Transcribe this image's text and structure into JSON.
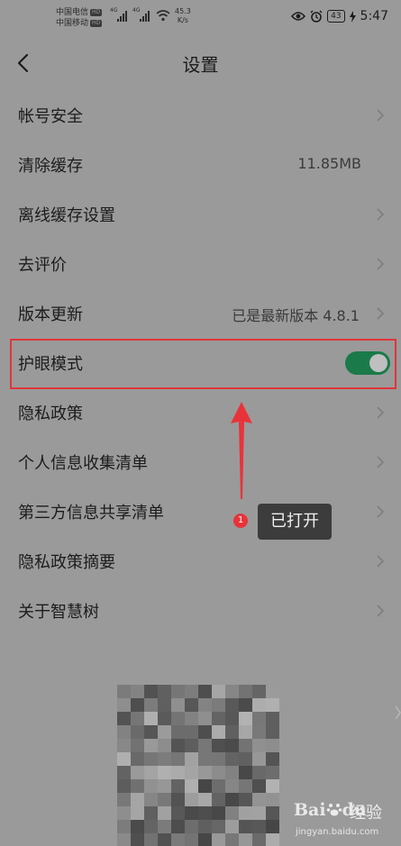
{
  "status_bar": {
    "carrier1": "中国电信",
    "carrier2": "中国移动",
    "hd": "HD",
    "sig_tag": "4G",
    "speed_value": "45.3",
    "speed_unit": "K/s",
    "battery": "43",
    "time": "5:47"
  },
  "header": {
    "title": "设置"
  },
  "rows": [
    {
      "label": "帐号安全"
    },
    {
      "label": "清除缓存",
      "value": "11.85MB"
    },
    {
      "label": "离线缓存设置"
    },
    {
      "label": "去评价"
    },
    {
      "label": "版本更新",
      "value": "已是最新版本  4.8.1"
    },
    {
      "label": "护眼模式",
      "toggle_on": true
    },
    {
      "label": "隐私政策"
    },
    {
      "label": "个人信息收集清单"
    },
    {
      "label": "第三方信息共享清单"
    },
    {
      "label": "隐私政策摘要"
    },
    {
      "label": "关于智慧树"
    }
  ],
  "annotation": {
    "badge": "1",
    "text": "已打开"
  },
  "watermark": {
    "brand": "Bai",
    "brand_suffix": "du",
    "jingyan": "经验",
    "url": "jingyan.baidu.com"
  },
  "colors": {
    "background": "#9a9a9a",
    "toggle_on": "#1b7a49",
    "highlight": "#e0353a",
    "arrow": "#e8333a"
  },
  "icons": [
    "back-arrow-icon",
    "chevron-right-icon",
    "eye-icon",
    "alarm-icon",
    "wifi-icon",
    "charging-icon",
    "qr-code"
  ]
}
